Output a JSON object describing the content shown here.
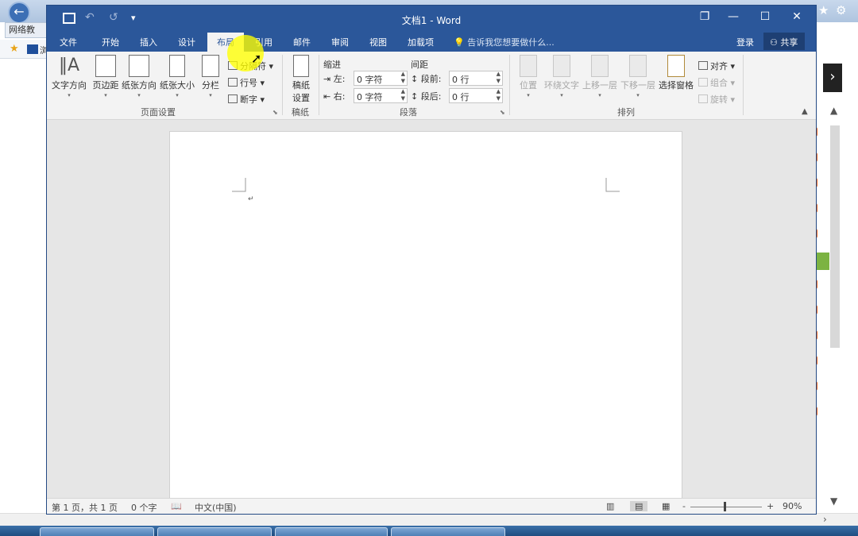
{
  "browser": {
    "tab_label": "网络教",
    "fav_text": "浏"
  },
  "window": {
    "title": "文档1 - Word",
    "controls": {
      "restore": "❐",
      "minimize": "—",
      "maximize": "☐",
      "close": "✕"
    }
  },
  "qat": {
    "save": "💾",
    "undo": "↶",
    "redo": "↺",
    "customize": "▾"
  },
  "tabs": [
    {
      "label": "文件"
    },
    {
      "label": "开始"
    },
    {
      "label": "插入"
    },
    {
      "label": "设计"
    },
    {
      "label": "布局"
    },
    {
      "label": "引用"
    },
    {
      "label": "邮件"
    },
    {
      "label": "审阅"
    },
    {
      "label": "视图"
    },
    {
      "label": "加载项"
    }
  ],
  "active_tab": "布局",
  "tell_me": "告诉我您想要做什么...",
  "login": "登录",
  "share": "共享",
  "ribbon": {
    "page_setup": {
      "label": "页面设置",
      "buttons": [
        "文字方向",
        "页边距",
        "纸张方向",
        "纸张大小",
        "分栏"
      ],
      "small": [
        "分隔符",
        "行号",
        "断字"
      ]
    },
    "manuscript": {
      "label": "稿纸",
      "button": "稿纸\n设置",
      "button_l1": "稿纸",
      "button_l2": "设置"
    },
    "paragraph": {
      "label": "段落",
      "indent_head": "缩进",
      "spacing_head": "间距",
      "left_label": "左:",
      "left_value": "0 字符",
      "right_label": "右:",
      "right_value": "0 字符",
      "before_label": "段前:",
      "before_value": "0 行",
      "after_label": "段后:",
      "after_value": "0 行"
    },
    "arrange": {
      "label": "排列",
      "buttons": [
        "位置",
        "环绕文字",
        "上移一层",
        "下移一层",
        "选择窗格"
      ],
      "small": [
        "对齐",
        "组合",
        "旋转"
      ]
    }
  },
  "status": {
    "page": "第 1 页，共 1 页",
    "words": "0 个字",
    "language": "中文(中国)",
    "zoom": "90%",
    "zoom_minus": "-",
    "zoom_plus": "+"
  },
  "colors": {
    "word_blue": "#2b579a",
    "ribbon_bg": "#f3f3f3",
    "highlight": "#ffff00"
  }
}
